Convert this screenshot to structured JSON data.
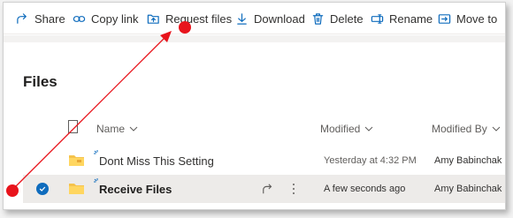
{
  "toolbar": {
    "items": [
      {
        "label": "Share",
        "icon": "share-icon"
      },
      {
        "label": "Copy link",
        "icon": "link-icon"
      },
      {
        "label": "Request files",
        "icon": "request-files-icon"
      },
      {
        "label": "Download",
        "icon": "download-icon"
      },
      {
        "label": "Delete",
        "icon": "trash-icon"
      },
      {
        "label": "Rename",
        "icon": "rename-icon"
      },
      {
        "label": "Move to",
        "icon": "move-to-icon"
      }
    ]
  },
  "page": {
    "title": "Files"
  },
  "columns": {
    "name": "Name",
    "modified": "Modified",
    "modified_by": "Modified By"
  },
  "rows": [
    {
      "name": "Dont Miss This Setting",
      "modified": "Yesterday at 4:32 PM",
      "modified_by": "Amy Babinchak",
      "selected": false
    },
    {
      "name": "Receive Files",
      "modified": "A few seconds ago",
      "modified_by": "Amy Babinchak",
      "selected": true
    }
  ],
  "colors": {
    "accent": "#0f6cbd",
    "folder": "#f5c34c",
    "annotation": "#e8141c",
    "selected_row": "#edebe9"
  },
  "annotation": {
    "type": "arrow",
    "from": "marker-near-selected-row",
    "to": "request-files-button"
  }
}
